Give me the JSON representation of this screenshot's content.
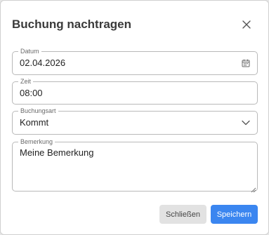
{
  "dialog": {
    "title": "Buchung nachtragen"
  },
  "fields": {
    "date": {
      "label": "Datum",
      "value": "02.04.2026"
    },
    "time": {
      "label": "Zeit",
      "value": "08:00"
    },
    "type": {
      "label": "Buchungsart",
      "value": "Kommt"
    },
    "note": {
      "label": "Bemerkung",
      "value": "Meine Bemerkung"
    }
  },
  "buttons": {
    "close_label": "Schließen",
    "save_label": "Speichern"
  },
  "icons": {
    "close": "close-icon",
    "calendar": "calendar-icon",
    "dropdown": "chevron-down-icon",
    "resize": "resize-grip-icon"
  },
  "colors": {
    "primary": "#3b86f0",
    "secondary_button": "#e2e2e2",
    "border": "#b9b9b9",
    "title": "#3a3a3a"
  }
}
